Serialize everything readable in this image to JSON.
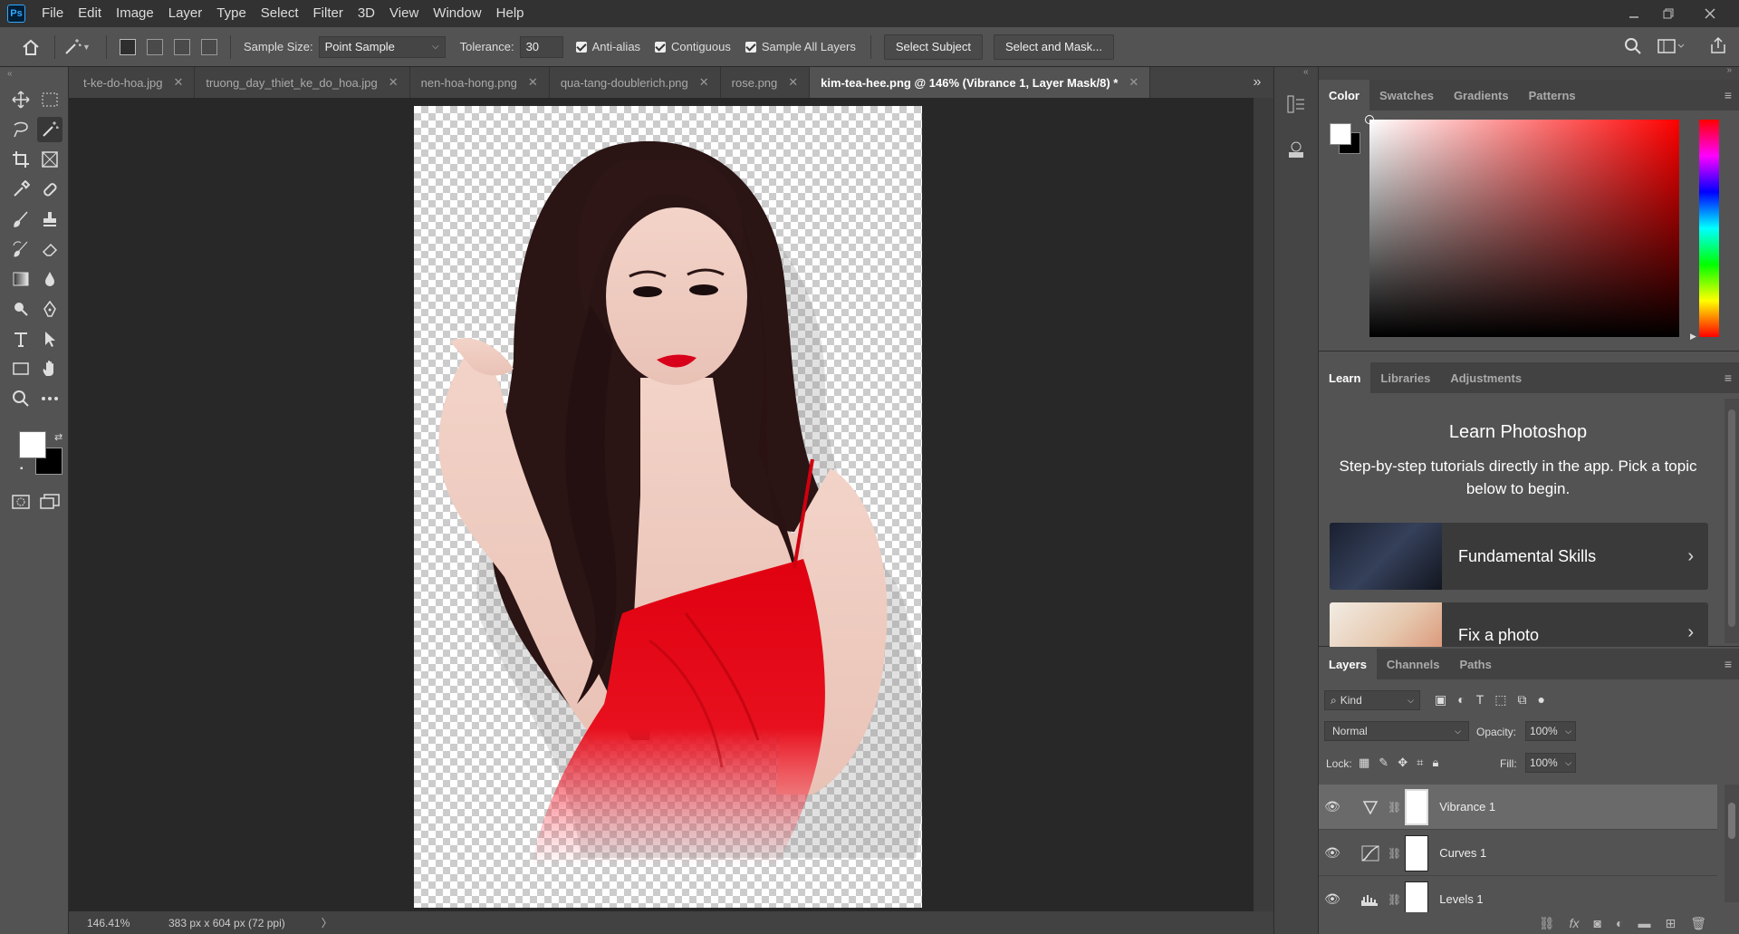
{
  "menubar": {
    "logo": "Ps",
    "items": [
      "File",
      "Edit",
      "Image",
      "Layer",
      "Type",
      "Select",
      "Filter",
      "3D",
      "View",
      "Window",
      "Help"
    ]
  },
  "options": {
    "sample_size_label": "Sample Size:",
    "sample_size_value": "Point Sample",
    "tolerance_label": "Tolerance:",
    "tolerance_value": "30",
    "anti_alias": "Anti-alias",
    "contiguous": "Contiguous",
    "sample_all_layers": "Sample All Layers",
    "select_subject": "Select Subject",
    "select_and_mask": "Select and Mask..."
  },
  "tabs": [
    {
      "label": "t-ke-do-hoa.jpg"
    },
    {
      "label": "truong_day_thiet_ke_do_hoa.jpg"
    },
    {
      "label": "nen-hoa-hong.png"
    },
    {
      "label": "qua-tang-doublerich.png"
    },
    {
      "label": "rose.png"
    },
    {
      "label": "kim-tea-hee.png @ 146% (Vibrance 1, Layer Mask/8) *"
    }
  ],
  "status": {
    "zoom": "146.41%",
    "doc_info": "383 px x 604 px (72 ppi)"
  },
  "color_panel": {
    "tabs": [
      "Color",
      "Swatches",
      "Gradients",
      "Patterns"
    ],
    "hue_color": "#ff0000"
  },
  "learn_panel": {
    "tabs": [
      "Learn",
      "Libraries",
      "Adjustments"
    ],
    "title": "Learn Photoshop",
    "description": "Step-by-step tutorials directly in the app. Pick a topic below to begin.",
    "cards": [
      {
        "label": "Fundamental Skills"
      },
      {
        "label": "Fix a photo"
      }
    ]
  },
  "layers_panel": {
    "tabs": [
      "Layers",
      "Channels",
      "Paths"
    ],
    "filter_kind": "Kind",
    "blend_mode": "Normal",
    "opacity_label": "Opacity:",
    "opacity_value": "100%",
    "lock_label": "Lock:",
    "fill_label": "Fill:",
    "fill_value": "100%",
    "layers": [
      {
        "name": "Vibrance 1",
        "icon": "vibrance-icon"
      },
      {
        "name": "Curves 1",
        "icon": "curves-icon"
      },
      {
        "name": "Levels 1",
        "icon": "levels-icon"
      }
    ]
  }
}
